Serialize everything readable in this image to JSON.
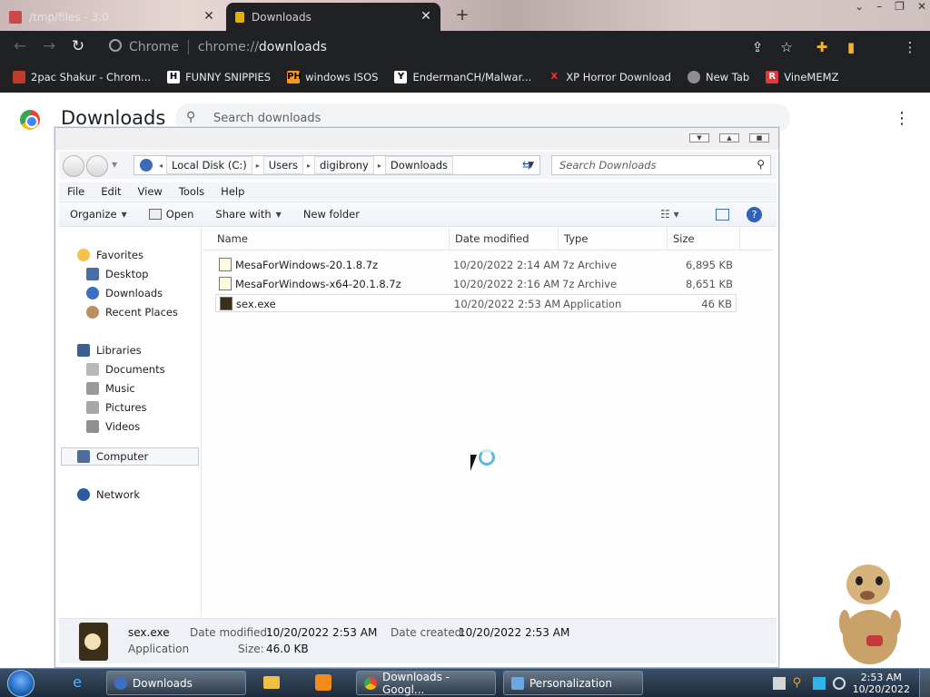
{
  "browser": {
    "tabs": [
      {
        "title": "/tmp/files - 3.0"
      },
      {
        "title": "Downloads"
      }
    ],
    "omnibox": {
      "site": "Chrome",
      "url_prefix": "chrome://",
      "url_host": "downloads"
    },
    "bookmarks": [
      {
        "label": "2pac Shakur - Chrom..."
      },
      {
        "label": "FUNNY SNIPPIES"
      },
      {
        "label": "windows ISOS"
      },
      {
        "label": "EndermanCH/Malwar..."
      },
      {
        "label": "XP Horror Download"
      },
      {
        "label": "New Tab"
      },
      {
        "label": "VineMEMZ"
      }
    ]
  },
  "downloads_page": {
    "title": "Downloads",
    "search_placeholder": "Search downloads"
  },
  "explorer": {
    "breadcrumbs": [
      "Local Disk (C:)",
      "Users",
      "digibrony",
      "Downloads"
    ],
    "search_placeholder": "Search Downloads",
    "menu": [
      "File",
      "Edit",
      "View",
      "Tools",
      "Help"
    ],
    "commands": {
      "organize": "Organize",
      "open": "Open",
      "share_with": "Share with",
      "new_folder": "New folder"
    },
    "nav": {
      "favorites": "Favorites",
      "desktop": "Desktop",
      "downloads": "Downloads",
      "recent": "Recent Places",
      "libraries": "Libraries",
      "documents": "Documents",
      "music": "Music",
      "pictures": "Pictures",
      "videos": "Videos",
      "computer": "Computer",
      "network": "Network"
    },
    "columns": [
      "Name",
      "Date modified",
      "Type",
      "Size"
    ],
    "files": [
      {
        "name": "MesaForWindows-20.1.8.7z",
        "date": "10/20/2022 2:14 AM",
        "type": "7z Archive",
        "size": "6,895 KB"
      },
      {
        "name": "MesaForWindows-x64-20.1.8.7z",
        "date": "10/20/2022 2:16 AM",
        "type": "7z Archive",
        "size": "8,651 KB"
      },
      {
        "name": "sex.exe",
        "date": "10/20/2022 2:53 AM",
        "type": "Application",
        "size": "46 KB"
      }
    ],
    "details": {
      "name": "sex.exe",
      "type": "Application",
      "modified_label": "Date modified:",
      "modified": "10/20/2022 2:53 AM",
      "created_label": "Date created:",
      "created": "10/20/2022 2:53 AM",
      "size_label": "Size:",
      "size": "46.0 KB"
    }
  },
  "taskbar": {
    "buttons": [
      {
        "label": "Downloads"
      },
      {
        "label": "Downloads - Googl..."
      },
      {
        "label": "Personalization"
      }
    ],
    "clock": {
      "time": "2:53 AM",
      "date": "10/20/2022"
    }
  },
  "colors": {
    "chrome_dark": "#202124",
    "selection_border": "#c5c9d0",
    "taskbar": "#1d2b3b"
  }
}
